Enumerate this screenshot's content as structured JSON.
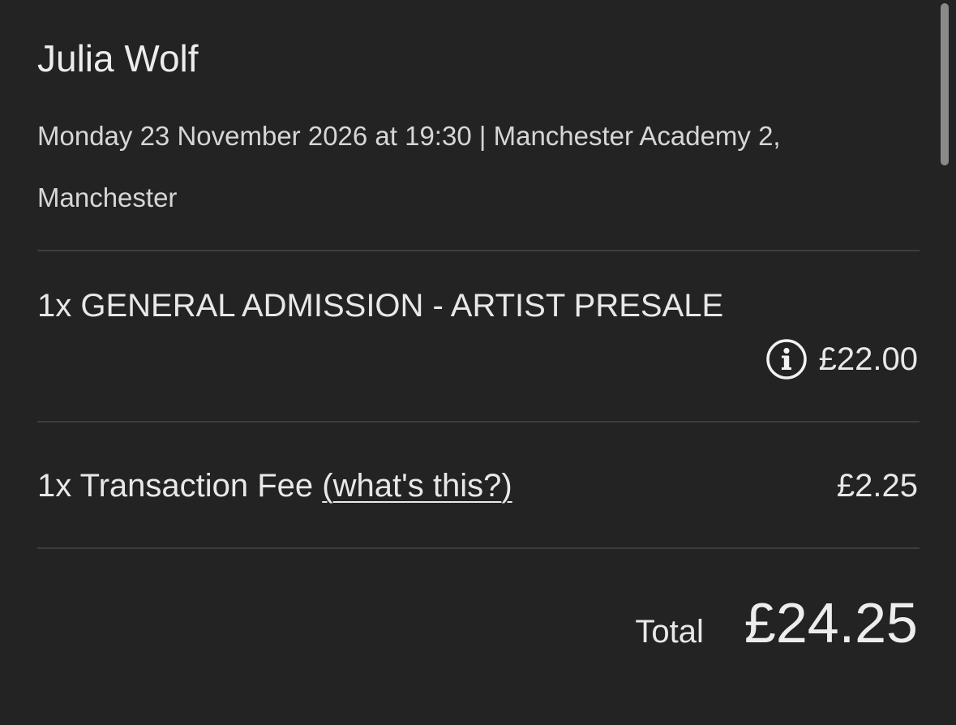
{
  "event": {
    "artist": "Julia Wolf",
    "details": "Monday 23 November 2026 at 19:30 | Manchester Academy 2, Manchester"
  },
  "ticket": {
    "description": "1x GENERAL ADMISSION - ARTIST PRESALE",
    "price": "£22.00",
    "info_icon": "info-circle-icon"
  },
  "fee": {
    "label": "1x Transaction Fee ",
    "open_paren": "(",
    "link_text": "what's this?",
    "close_paren": ")",
    "amount": "£2.25"
  },
  "total": {
    "label": "Total",
    "value": "£24.25"
  },
  "colors": {
    "background": "#232323",
    "text": "#e8e8e8",
    "divider": "#3d3d3d"
  }
}
